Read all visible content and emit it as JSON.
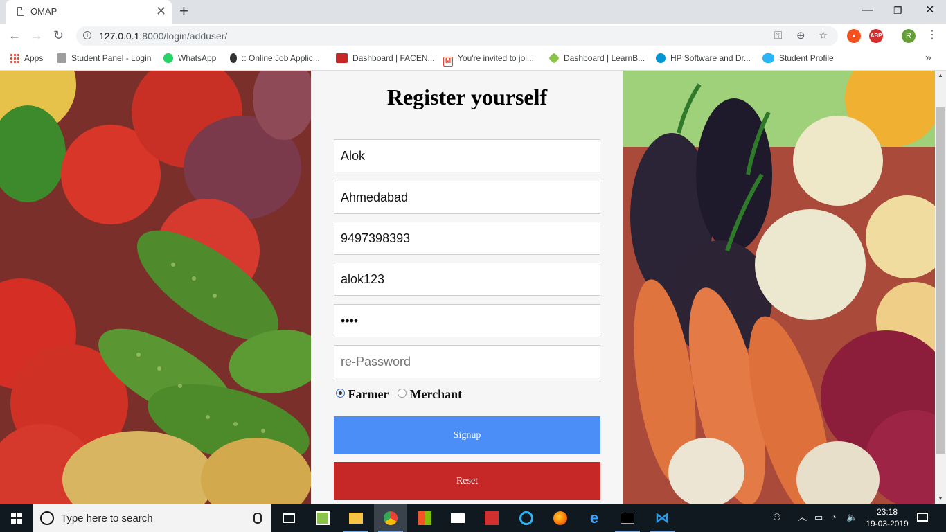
{
  "browser": {
    "tab_title": "OMAP",
    "url_host": "127.0.0.1",
    "url_rest": ":8000/login/adduser/",
    "avatar_letter": "R",
    "ext_abp": "ABP"
  },
  "bookmarks": [
    "Apps",
    "Student Panel - Login",
    "WhatsApp",
    ":: Online Job Applic...",
    "Dashboard | FACEN...",
    "You're invited to joi...",
    "Dashboard | LearnB...",
    "HP Software and Dr...",
    "Student Profile"
  ],
  "form": {
    "title": "Register yourself",
    "fields": [
      {
        "value": "Alok",
        "placeholder": "",
        "type": "text"
      },
      {
        "value": "Ahmedabad",
        "placeholder": "",
        "type": "text"
      },
      {
        "value": "9497398393",
        "placeholder": "",
        "type": "text"
      },
      {
        "value": "alok123",
        "placeholder": "",
        "type": "text"
      },
      {
        "value": "abcd",
        "placeholder": "",
        "type": "password"
      },
      {
        "value": "",
        "placeholder": "re-Password",
        "type": "password"
      }
    ],
    "role_options": [
      "Farmer",
      "Merchant"
    ],
    "role_selected": "Farmer",
    "signup_label": "Signup",
    "reset_label": "Reset"
  },
  "taskbar": {
    "search_placeholder": "Type here to search",
    "time": "23:18",
    "date": "19-03-2019"
  },
  "colors": {
    "signup": "#4c8ef7",
    "reset": "#c62828"
  }
}
